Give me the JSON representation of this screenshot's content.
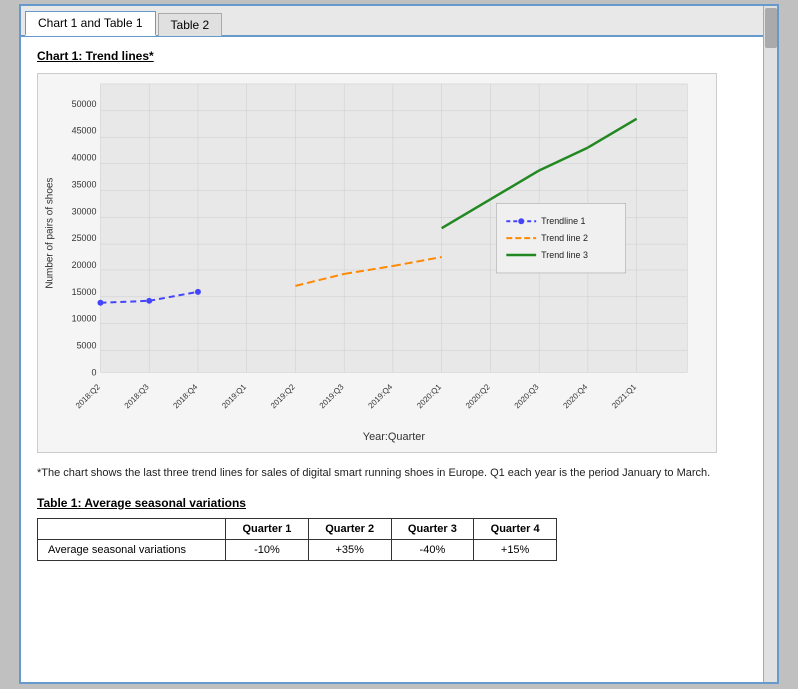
{
  "tabs": [
    {
      "id": "tab1",
      "label": "Chart 1 and Table 1",
      "active": false
    },
    {
      "id": "tab2",
      "label": "Table 2",
      "active": true
    }
  ],
  "chart": {
    "title": "Chart 1: Trend lines*",
    "y_axis_label": "Number of pairs of shoes",
    "x_axis_label": "Year:Quarter",
    "y_ticks": [
      "0",
      "5000",
      "10000",
      "15000",
      "20000",
      "25000",
      "30000",
      "35000",
      "40000",
      "45000",
      "50000"
    ],
    "x_ticks": [
      "2018:Q2",
      "2018:Q3",
      "2018:Q4",
      "2019:Q1",
      "2019:Q2",
      "2019:Q3",
      "2019:Q4",
      "2020:Q1",
      "2020:Q2",
      "2020:Q3",
      "2020:Q4",
      "2021:Q1"
    ],
    "legend": [
      {
        "label": "Trendline 1",
        "style": "dashed-blue"
      },
      {
        "label": "Trend line 2",
        "style": "dashed-orange"
      },
      {
        "label": "Trend line 3",
        "style": "solid-green"
      }
    ]
  },
  "footnote": "*The chart shows the last three trend lines for sales of digital smart running shoes in Europe. Q1 each year is the period January to March.",
  "table": {
    "title": "Table 1: Average seasonal variations",
    "headers": [
      "",
      "Quarter 1",
      "Quarter 2",
      "Quarter 3",
      "Quarter 4"
    ],
    "rows": [
      [
        "Average seasonal variations",
        "-10%",
        "+35%",
        "-40%",
        "+15%"
      ]
    ]
  }
}
